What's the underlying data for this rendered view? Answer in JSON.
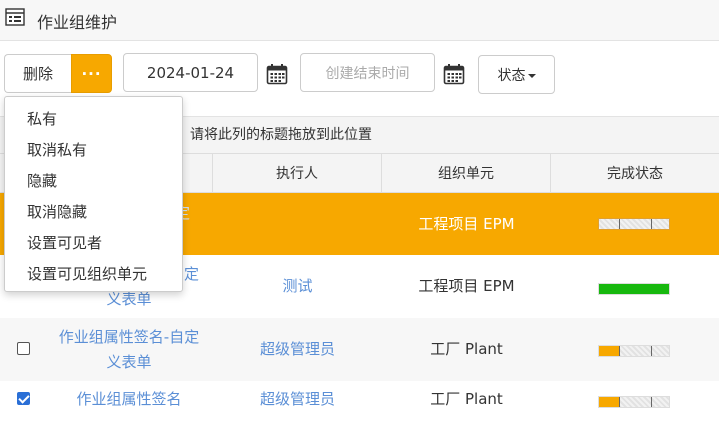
{
  "titlebar": {
    "title": "作业组维护",
    "icon": "form-grid-icon"
  },
  "toolbar": {
    "delete_label": "删除",
    "more_label": "···",
    "date_value": "2024-01-24",
    "end_time_placeholder": "创建结束时间",
    "status_label": "状态",
    "accent_color": "#f7a800"
  },
  "group_hint": "，请将此列的标题拖放到此位置",
  "columns": [
    "执行人",
    "组织单元",
    "完成状态"
  ],
  "dropdown_menu": {
    "items": [
      "私有",
      "取消私有",
      "隐藏",
      "取消隐藏",
      "设置可见者",
      "设置可见组织单元"
    ]
  },
  "rows": [
    {
      "name_partial": "自定",
      "executor": "",
      "org_unit": "工程项目 EPM",
      "status": "hatched",
      "highlight_color": "#f7a800",
      "progress": 0
    },
    {
      "name_partial": "自定",
      "name_line2": "义表单",
      "executor": "测试",
      "org_unit": "工程项目 EPM",
      "status": "complete",
      "fill_color": "#17b80e",
      "progress": 1.0
    },
    {
      "checked": false,
      "name_line1": "作业组属性签名-自定",
      "name_line2": "义表单",
      "executor": "超级管理员",
      "org_unit": "工厂 Plant",
      "status": "partial",
      "fill_color": "#f7a800",
      "progress": 0.28
    },
    {
      "checked": true,
      "name_line1": "作业组属性签名",
      "executor": "超级管理员",
      "org_unit": "工厂 Plant",
      "status": "partial",
      "fill_color": "#f7a800",
      "progress": 0.28
    }
  ]
}
